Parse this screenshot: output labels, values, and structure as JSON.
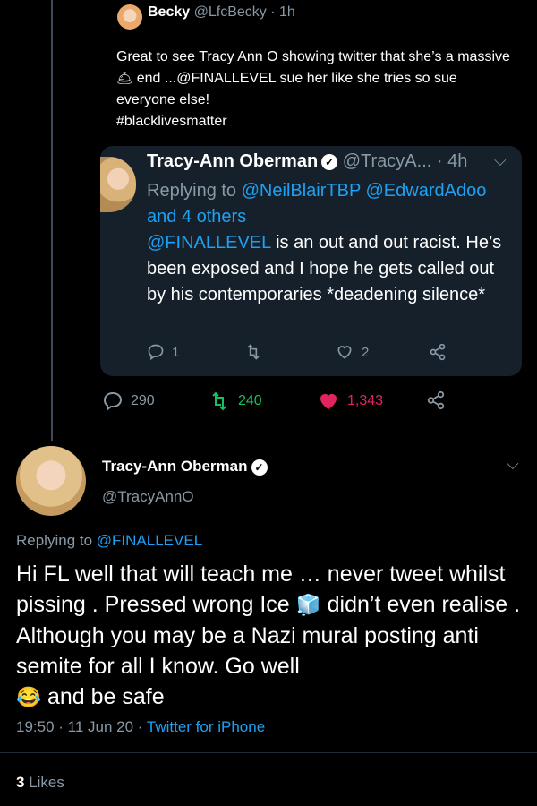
{
  "quote_tweet": {
    "name": "Becky",
    "handle": "@LfcBecky",
    "time": "1h",
    "text_1": "Great to see Tracy Ann O showing twitter that she’s a massive",
    "bell_emoji": "🛎",
    "text_2": " end ...@FINALLEVEL sue her like she tries so sue everyone else!",
    "hashtag": "#blacklivesmatter"
  },
  "embedded_tweet": {
    "name": "Tracy-Ann Oberman",
    "handle": "@TracyA...",
    "time": "4h",
    "replying_prefix": "Replying to ",
    "replying_1": "@NeilBlairTBP",
    "replying_2": "@EdwardAdoo",
    "replying_3": "and 4 others",
    "mention": "@FINALLEVEL",
    "text": " is an out and out racist. He’s been exposed and I hope he gets called out by his contemporaries *deadening silence*",
    "replies": "1",
    "likes": "2"
  },
  "quote_actions": {
    "replies": "290",
    "retweets": "240",
    "likes": "1,343"
  },
  "main_tweet": {
    "name": "Tracy-Ann Oberman",
    "handle": "@TracyAnnO",
    "replying_prefix": "Replying to ",
    "replying_to": "@FINALLEVEL",
    "text_1": "Hi FL well that will teach me … never tweet whilst pissing . Pressed wrong Ice",
    "ice_emoji": "🧊",
    "text_2": " didn’t even realise . Although you may be a Nazi mural posting anti semite for all I know. Go well",
    "laugh_emoji": "😂",
    "text_3": " and be safe",
    "time": "19:50 · 11 Jun 20 · ",
    "client": "Twitter for iPhone",
    "likes_count": "3",
    "likes_label": " Likes"
  },
  "colors": {
    "background": "#000000",
    "card": "#15202b",
    "link": "#1da1f2",
    "muted": "#8899a6",
    "retweet": "#17bf63",
    "like": "#e0245e"
  }
}
